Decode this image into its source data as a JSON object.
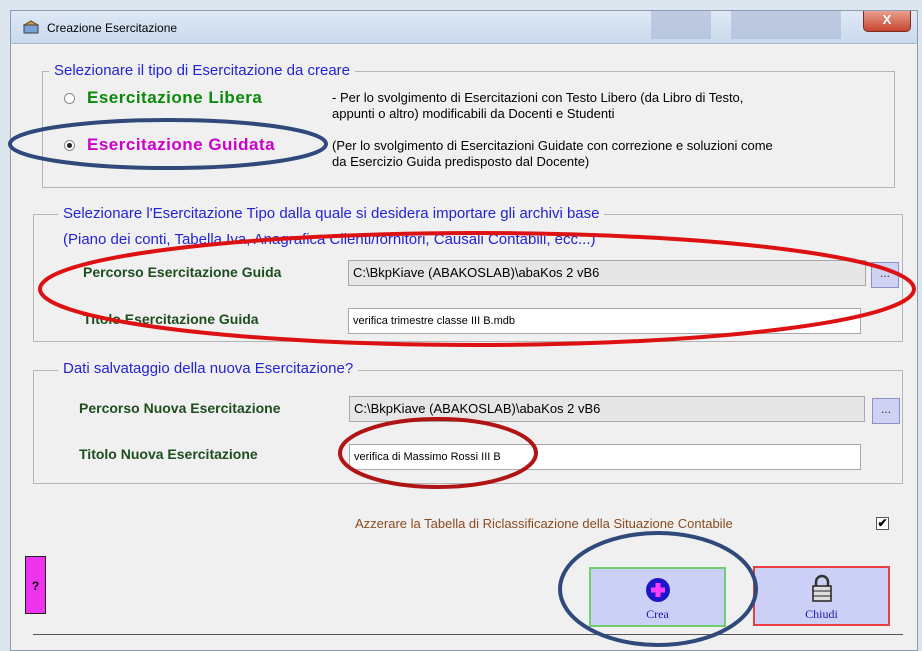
{
  "window": {
    "title": "Creazione Esercitazione",
    "close_label": "X"
  },
  "tipo_group": {
    "legend": "Selezionare il tipo di Esercitazione da creare",
    "options": [
      {
        "label": "Esercitazione Libera",
        "color": "#0a8a0a",
        "desc_line1": "- Per lo svolgimento di Esercitazioni con Testo Libero (da Libro di Testo,",
        "desc_line2": "appunti o altro) modificabili da Docenti e Studenti",
        "selected": false
      },
      {
        "label": "Esercitazione Guidata",
        "color": "#cc00cc",
        "desc_line1": "(Per lo svolgimento di Esercitazioni Guidate con correzione e soluzioni come",
        "desc_line2": "da Esercizio Guida predisposto dal Docente)",
        "selected": true
      }
    ]
  },
  "import_group": {
    "legend_line1": "Selezionare l'Esercitazione Tipo dalla quale si desidera importare gli archivi base",
    "legend_line2": "(Piano dei conti, Tabella Iva, Anagrafica Clienti/fornitori, Causali Contabili, ecc...)",
    "percorso_label": "Percorso Esercitazione Guida",
    "percorso_value": "C:\\BkpKiave (ABAKOSLAB)\\abaKos 2 vB6",
    "titolo_label": "Titolo Esercitazione Guida",
    "titolo_value": "verifica trimestre classe III B.mdb",
    "browse_label": "..."
  },
  "new_group": {
    "legend": "Dati  salvataggio della nuova Esercitazione?",
    "percorso_label": "Percorso Nuova Esercitazione",
    "percorso_value": "C:\\BkpKiave (ABAKOSLAB)\\abaKos 2 vB6",
    "titolo_label": "Titolo Nuova Esercitazione",
    "titolo_value": "verifica di Massimo Rossi III B",
    "browse_label": "..."
  },
  "azzera": {
    "label": "Azzerare la Tabella di Riclassificazione della Situazione Contabile",
    "checked": true,
    "check_mark": "✔"
  },
  "buttons": {
    "help": "?",
    "crea": "Crea",
    "chiudi": "Chiudi"
  },
  "colors": {
    "annotation_red": "#dd1111",
    "annotation_blue": "#2f4a7a"
  }
}
